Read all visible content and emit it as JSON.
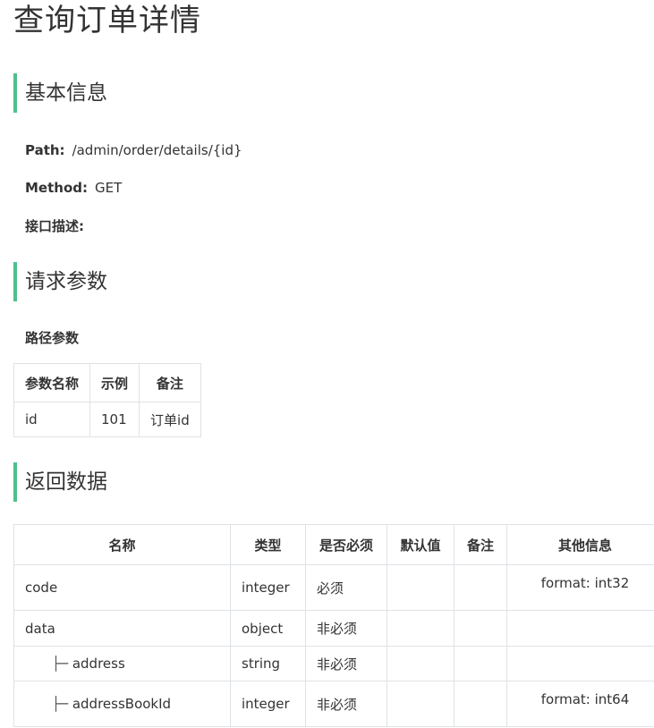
{
  "title": "查询订单详情",
  "sections": {
    "basic": "基本信息",
    "request": "请求参数",
    "response": "返回数据"
  },
  "basic_info": {
    "path_label": "Path:",
    "path_value": "/admin/order/details/{id}",
    "method_label": "Method:",
    "method_value": "GET",
    "desc_label": "接口描述:"
  },
  "path_params": {
    "title": "路径参数",
    "headers": [
      "参数名称",
      "示例",
      "备注"
    ],
    "rows": [
      [
        "id",
        "101",
        "订单id"
      ]
    ]
  },
  "response_table": {
    "headers": [
      "名称",
      "类型",
      "是否必须",
      "默认值",
      "备注",
      "其他信息"
    ],
    "tree_prefix": "├─",
    "rows": [
      {
        "name": "code",
        "type": "integer",
        "required": "必须",
        "default": "",
        "note": "",
        "other": "format: int32"
      },
      {
        "name": "data",
        "type": "object",
        "required": "非必须",
        "default": "",
        "note": "",
        "other": ""
      },
      {
        "name": "address",
        "type": "string",
        "required": "非必须",
        "default": "",
        "note": "",
        "other": ""
      },
      {
        "name": "addressBookId",
        "type": "integer",
        "required": "非必须",
        "default": "",
        "note": "",
        "other": "format: int64"
      }
    ]
  }
}
